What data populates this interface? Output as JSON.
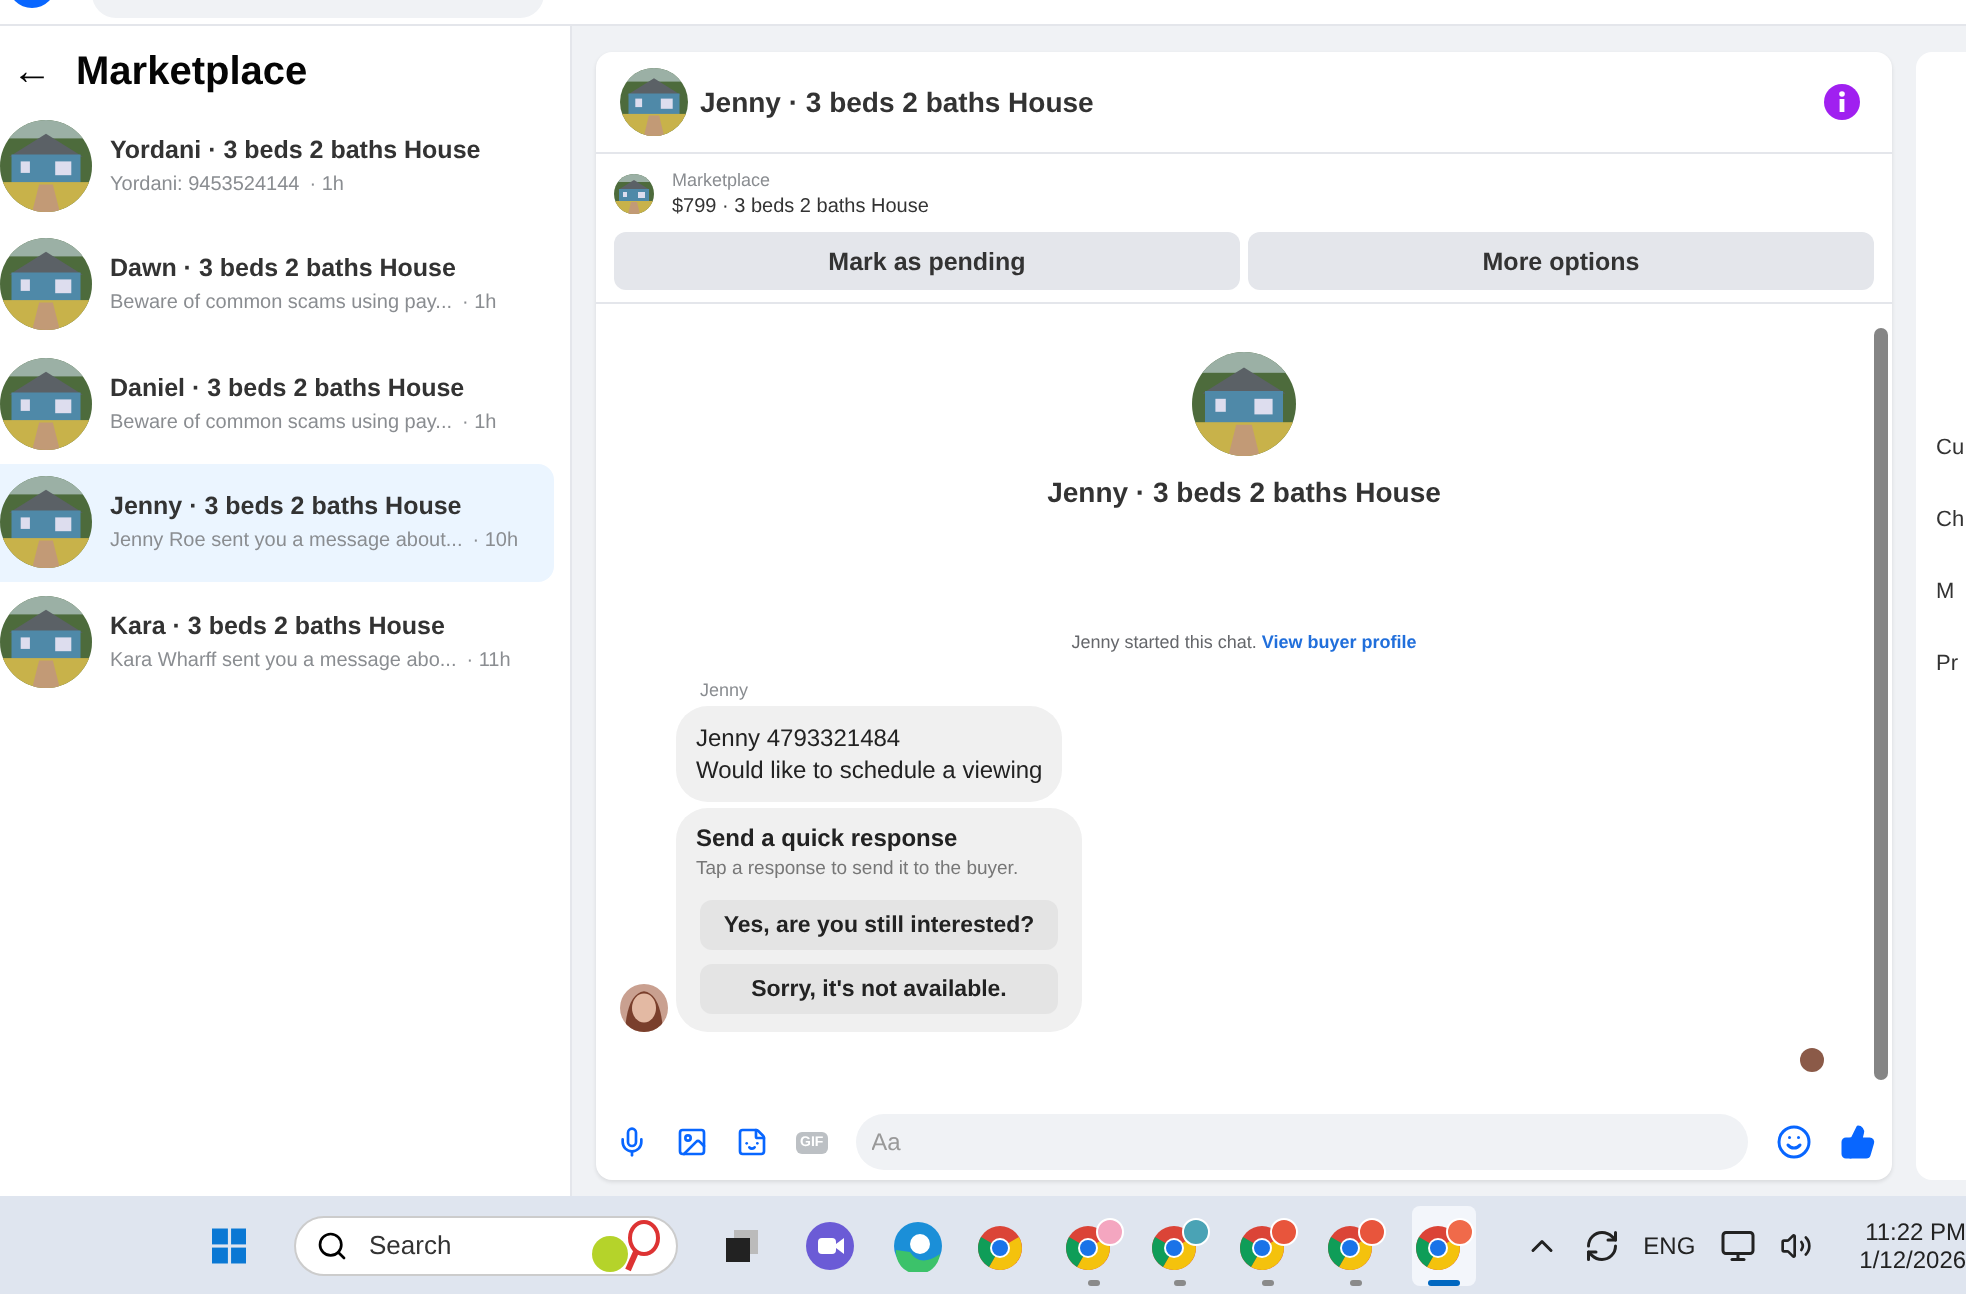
{
  "sidebar": {
    "back": "←",
    "title": "Marketplace",
    "conversations": [
      {
        "title": "Yordani · 3 beds 2 baths House",
        "preview": "Yordani: 9453524144",
        "time": "· 1h",
        "selected": false
      },
      {
        "title": "Dawn · 3 beds 2 baths House",
        "preview": "Beware of common scams using pay...",
        "time": "· 1h",
        "selected": false
      },
      {
        "title": "Daniel · 3 beds 2 baths House",
        "preview": "Beware of common scams using pay...",
        "time": "· 1h",
        "selected": false
      },
      {
        "title": "Jenny · 3 beds 2 baths House",
        "preview": "Jenny Roe sent you a message about...",
        "time": "· 10h",
        "selected": true
      },
      {
        "title": "Kara · 3 beds 2 baths House",
        "preview": "Kara Wharff sent you a message abo...",
        "time": "· 11h",
        "selected": false
      }
    ]
  },
  "chat": {
    "title": "Jenny · 3 beds 2 baths House",
    "listing": {
      "label": "Marketplace",
      "summary": "$799 · 3 beds 2 baths House",
      "buttons": [
        "Mark as pending",
        "More options"
      ]
    },
    "intro": {
      "title": "Jenny · 3 beds 2 baths House",
      "started": "Jenny started this chat.",
      "link": "View buyer profile"
    },
    "message": {
      "sender": "Jenny",
      "lines": [
        "Jenny 4793321484",
        "Would like to schedule a viewing"
      ]
    },
    "quick_response": {
      "title": "Send a quick response",
      "subtitle": "Tap a response to send it to the buyer.",
      "options": [
        "Yes, are you still interested?",
        "Sorry, it's not available."
      ]
    },
    "composer": {
      "gif": "GIF",
      "placeholder": "Aa"
    }
  },
  "details_panel": {
    "labels": [
      "Cu",
      "Ch",
      "M",
      "Pr"
    ]
  },
  "taskbar": {
    "search": {
      "placeholder": "Search"
    },
    "apps": [
      {
        "kind": "taskview",
        "selected": false,
        "running": false
      },
      {
        "kind": "meet",
        "selected": false,
        "running": false
      },
      {
        "kind": "edge",
        "selected": false,
        "running": false
      },
      {
        "kind": "chrome",
        "selected": false,
        "running": false
      },
      {
        "kind": "chrome-profile",
        "color": "#f4a6c0",
        "selected": false,
        "running": true
      },
      {
        "kind": "chrome-profile",
        "color": "#4aa3b5",
        "selected": false,
        "running": true
      },
      {
        "kind": "chrome-profile",
        "color": "#e8553c",
        "selected": false,
        "running": true
      },
      {
        "kind": "chrome-profile",
        "color": "#e8553c",
        "selected": false,
        "running": true
      },
      {
        "kind": "chrome-profile",
        "color": "#f06a4a",
        "selected": true,
        "running": true
      }
    ],
    "language": "ENG",
    "time": "11:22 PM",
    "date": "1/12/2026"
  }
}
